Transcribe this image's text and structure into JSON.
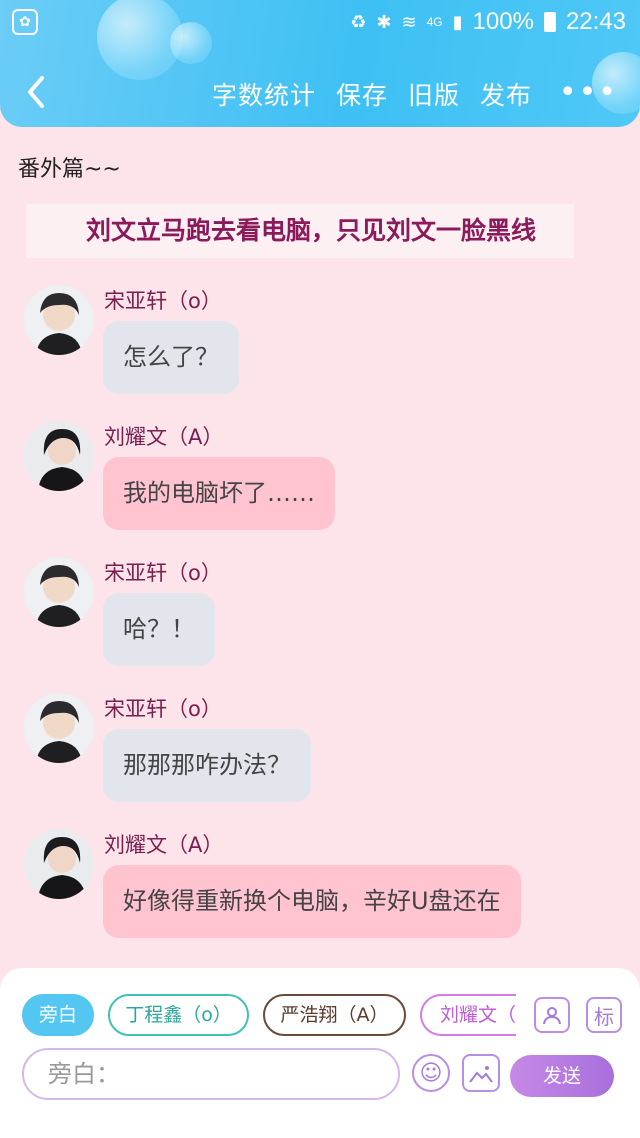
{
  "status_bar": {
    "battery": "100%",
    "time": "22:43",
    "network": "4G"
  },
  "nav": {
    "actions": [
      "字数统计",
      "保存",
      "旧版",
      "发布"
    ],
    "more": "•••"
  },
  "content": {
    "chapter_title": "番外篇~~",
    "narration": "刘文立马跑去看电脑，只见刘文一脸黑线",
    "messages": [
      {
        "speaker": "宋亚轩（o）",
        "text": "怎么了？",
        "style": "grey"
      },
      {
        "speaker": "刘耀文（A）",
        "text": "我的电脑坏了……",
        "style": "pink"
      },
      {
        "speaker": "宋亚轩（o）",
        "text": "哈？！",
        "style": "grey"
      },
      {
        "speaker": "宋亚轩（o）",
        "text": "那那那咋办法？",
        "style": "grey"
      },
      {
        "speaker": "刘耀文（A）",
        "text": "好像得重新换个电脑，辛好U盘还在",
        "style": "pink"
      }
    ]
  },
  "composer": {
    "chips": [
      "旁白",
      "丁程鑫（o）",
      "严浩翔（A）",
      "刘耀文（A）"
    ],
    "mark_label": "标",
    "input_placeholder": "旁白：",
    "send_label": "发送"
  },
  "colors": {
    "header_blue": "#3ec0f4",
    "background_pink": "#fde3ea",
    "bubble_grey": "#e2e5ec",
    "bubble_pink": "#ffc4d0",
    "send_purple": "#b47ce2"
  }
}
